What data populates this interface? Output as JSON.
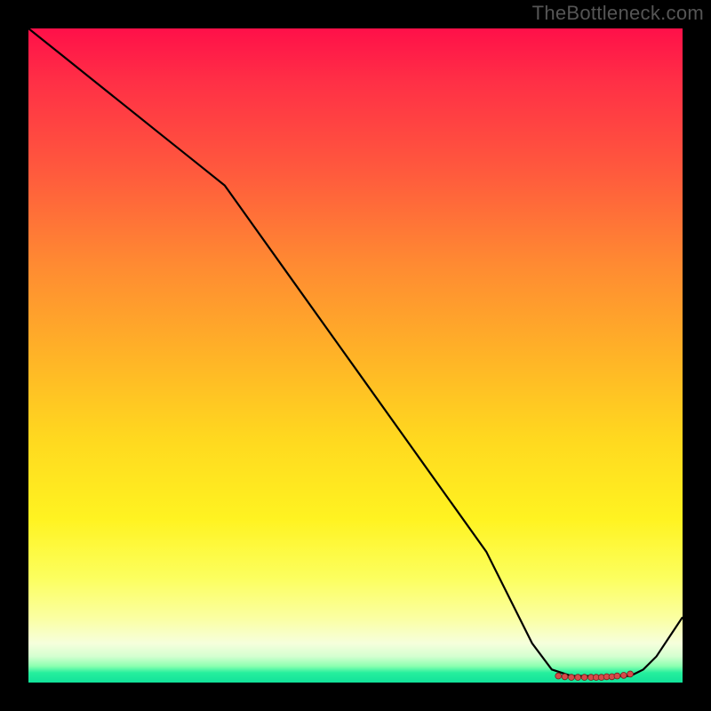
{
  "attribution": "TheBottleneck.com",
  "colors": {
    "frame": "#000000",
    "line": "#000000",
    "marker_fill": "#d64a4a",
    "marker_stroke": "#7a1f1f",
    "gradient_top": "#ff1049",
    "gradient_bottom": "#11e29a"
  },
  "chart_data": {
    "type": "line",
    "title": "",
    "xlabel": "",
    "ylabel": "",
    "xlim": [
      0,
      100
    ],
    "ylim": [
      0,
      100
    ],
    "grid": false,
    "series": [
      {
        "name": "curve",
        "x": [
          0,
          5,
          10,
          15,
          20,
          25,
          30,
          40,
          50,
          60,
          70,
          77,
          80,
          83,
          86,
          89,
          92,
          94,
          96,
          100
        ],
        "y": [
          100,
          96,
          92,
          88,
          84,
          80,
          76,
          62,
          48,
          34,
          20,
          6,
          2,
          1,
          1,
          1,
          1,
          2,
          4,
          10
        ]
      }
    ],
    "markers": {
      "name": "highlight-cluster",
      "x": [
        81,
        82,
        83,
        84,
        85,
        86,
        86.8,
        87.6,
        88.4,
        89.2,
        90,
        91,
        92
      ],
      "y": [
        1.0,
        0.9,
        0.8,
        0.8,
        0.8,
        0.8,
        0.8,
        0.8,
        0.9,
        0.9,
        1.0,
        1.1,
        1.3
      ]
    }
  }
}
